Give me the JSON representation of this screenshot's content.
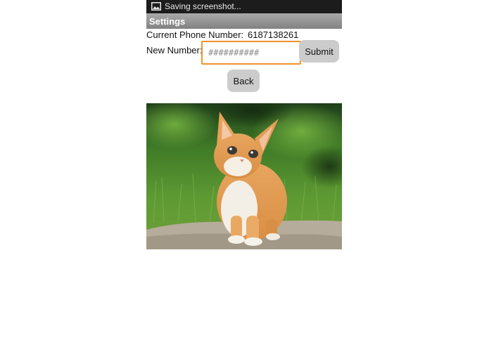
{
  "status_bar": {
    "icon": "image-icon",
    "text": "Saving screenshot..."
  },
  "title_bar": {
    "title": "Settings"
  },
  "current_phone": {
    "label": "Current Phone Number:",
    "value": "6187138261"
  },
  "new_number": {
    "label": "New Number:",
    "placeholder": "##########",
    "value": ""
  },
  "buttons": {
    "submit_label": "Submit",
    "back_label": "Back"
  },
  "image": {
    "subject": "kitten-photo"
  },
  "colors": {
    "status_bar_bg": "#1c1c1c",
    "title_bar_bg": "#969696",
    "input_focus_border": "#f0932b",
    "button_bg": "#cccccc"
  }
}
